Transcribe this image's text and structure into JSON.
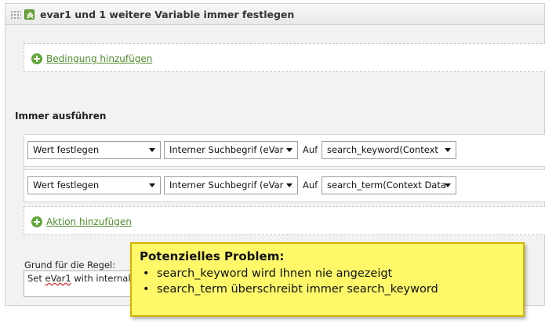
{
  "rule": {
    "title": "evar1 und 1 weitere Variable immer festlegen"
  },
  "conditions": {
    "add_label": "Bedingung hinzufügen"
  },
  "actions_section": {
    "heading": "Immer ausführen",
    "rows": [
      {
        "action": "Wert festlegen",
        "variable": "Interner Suchbegrif (eVar",
        "on_label": "Auf",
        "value": "search_keyword(Context"
      },
      {
        "action": "Wert festlegen",
        "variable": "Interner Suchbegrif (eVar",
        "on_label": "Auf",
        "value": "search_term(Context Data"
      }
    ],
    "add_label": "Aktion hinzufügen"
  },
  "reason": {
    "label": "Grund für die Regel:",
    "text_prefix": "Set ",
    "text_misspelled": "eVar1",
    "text_suffix": " with internal"
  },
  "callout": {
    "title": "Potenzielles Problem:",
    "items": [
      "search_keyword wird Ihnen nie angezeigt",
      "search_term überschreibt immer search_keyword"
    ]
  },
  "colors": {
    "accent_green": "#62a83a",
    "callout_yellow": "#fff96a"
  }
}
